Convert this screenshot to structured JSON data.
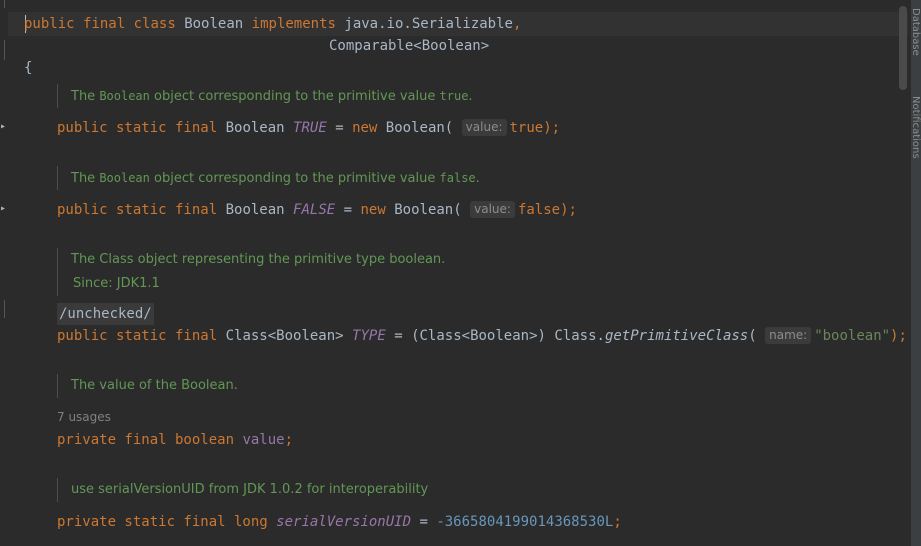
{
  "code": {
    "l1": {
      "public": "public",
      "final": "final",
      "class": "class",
      "name": "Boolean",
      "implements": "implements",
      "iface1": "java.io.Serializable",
      "comma": ","
    },
    "l2": {
      "iface2": "Comparable<Boolean>"
    },
    "brace_open": "{",
    "doc_true": {
      "pre": "The ",
      "code": "Boolean",
      "mid": " object corresponding to the primitive value ",
      "val": "true",
      "post": "."
    },
    "true_line": {
      "mods": "public static final",
      "type": "Boolean",
      "field": "TRUE",
      "eq": " = ",
      "new": "new",
      "ctor": "Boolean(",
      "hint": "value:",
      "arg": "true",
      "end": ");"
    },
    "doc_false": {
      "pre": "The ",
      "code": "Boolean",
      "mid": " object corresponding to the primitive value ",
      "val": "false",
      "post": "."
    },
    "false_line": {
      "mods": "public static final",
      "type": "Boolean",
      "field": "FALSE",
      "eq": " = ",
      "new": "new",
      "ctor": "Boolean(",
      "hint": "value:",
      "arg": "false",
      "end": ");"
    },
    "doc_class": {
      "line1": "The Class object representing the primitive type boolean.",
      "line2": "Since: JDK1.1"
    },
    "annotation": "/unchecked/",
    "type_line": {
      "mods": "public static final",
      "type": "Class<Boolean>",
      "field": "TYPE",
      "eq": " = ",
      "cast": "(Class<Boolean>) Class.",
      "method": "getPrimitiveClass",
      "paren": "(",
      "hint": "name:",
      "arg": "\"boolean\"",
      "end": ");"
    },
    "doc_value": "The value of the Boolean.",
    "usages": "7 usages",
    "value_line": {
      "mods": "private final boolean",
      "field": "value",
      "end": ";"
    },
    "doc_serial": "use serialVersionUID from JDK 1.0.2 for interoperability",
    "serial_line": {
      "mods": "private static final long",
      "field": "serialVersionUID",
      "eq": " = ",
      "num": "-3665804199014368530L",
      "end": ";"
    }
  },
  "sidebar_right": {
    "tab1": "Database",
    "tab2": "Notifications"
  },
  "colors": {
    "background": "#2b2b2b",
    "keyword": "#cc7832",
    "field": "#9876aa",
    "string": "#6a8759",
    "number": "#6897bb",
    "doc": "#629755"
  }
}
